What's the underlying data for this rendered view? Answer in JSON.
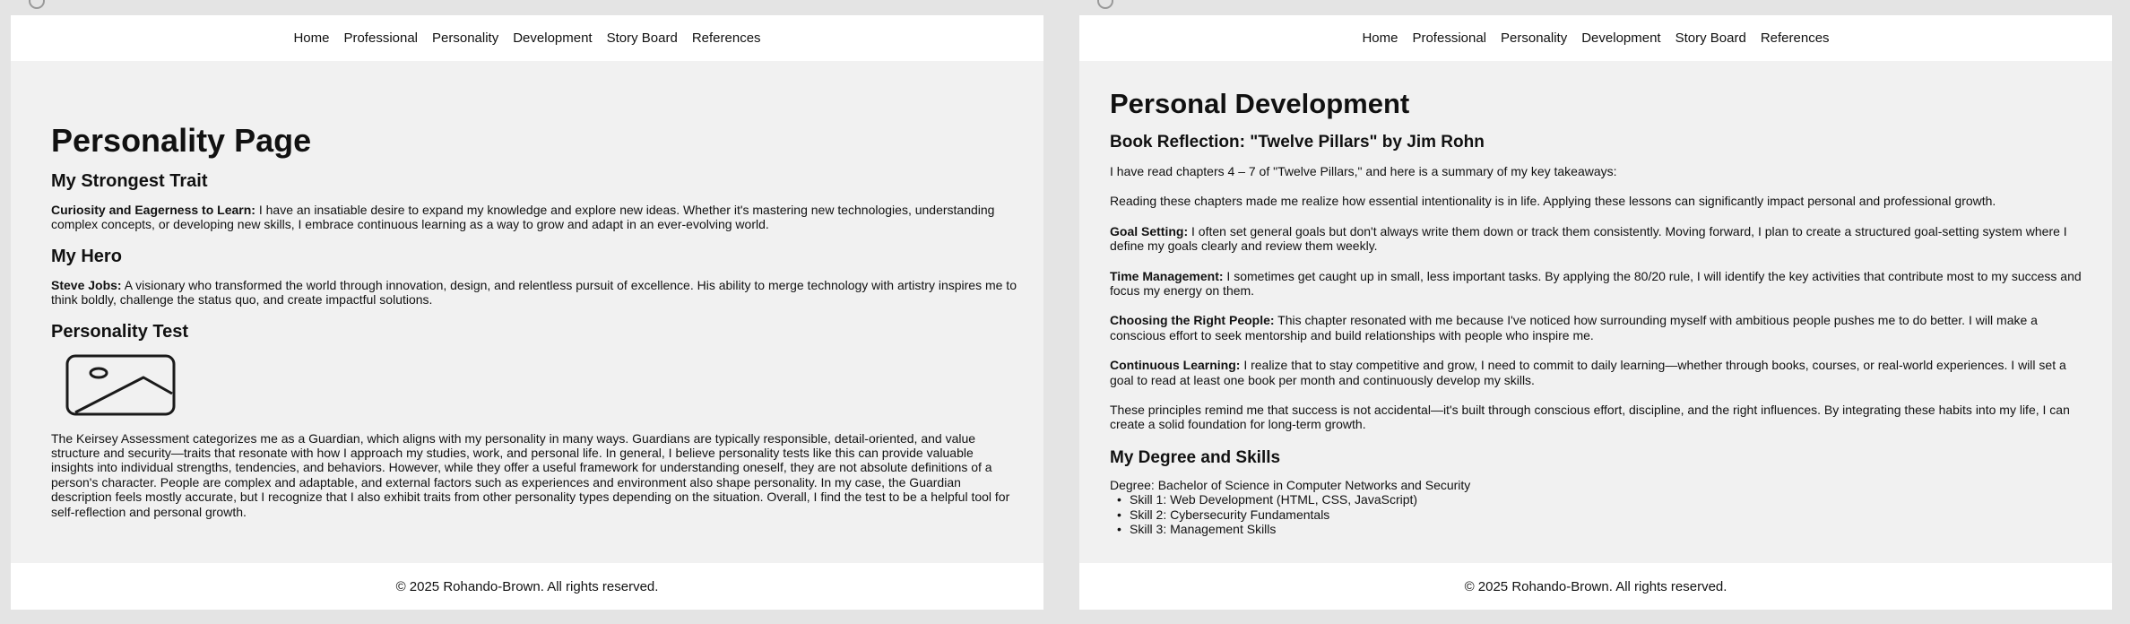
{
  "left_page": {
    "nav": [
      "Home",
      "Professional",
      "Personality",
      "Development",
      "Story Board",
      "References"
    ],
    "title": "Personality Page",
    "trait_heading": "My Strongest Trait",
    "trait_label": "Curiosity and Eagerness to Learn:",
    "trait_text": " I have an insatiable desire to expand my knowledge and explore new ideas. Whether it's mastering  new technologies, understanding complex concepts, or developing new  skills, I embrace continuous learning as a way to grow and adapt in an  ever-evolving world.",
    "hero_heading": "My Hero",
    "hero_label": "Steve Jobs:",
    "hero_text": " A visionary who transformed the world through  innovation, design, and relentless pursuit of excellence. His ability to merge technology with artistry inspires me to think boldly, challenge  the status quo, and create impactful solutions.",
    "test_heading": "Personality Test",
    "test_image_icon": "image-placeholder-icon",
    "test_text": "The Keirsey Assessment categorizes me as a Guardian, which  aligns with my personality in many ways. Guardians are typically  responsible, detail-oriented, and value structure and security—traits  that resonate with how I approach my studies, work, and personal life.  In general, I believe personality tests like this can provide valuable insights into individual strengths, tendencies, and behaviors. However,  while they offer a useful framework for understanding oneself, they are  not absolute definitions of a person's character. People are complex and adaptable, and external factors such as experiences and environment  also shape personality. In my case, the Guardian description feels  mostly accurate, but I recognize that I also exhibit traits from other  personality types depending on the situation. Overall, I find the test  to be a helpful tool for self-reflection and personal growth.",
    "footer": "© 2025 Rohando-Brown. All rights reserved."
  },
  "right_page": {
    "nav": [
      "Home",
      "Professional",
      "Personality",
      "Development",
      "Story Board",
      "References"
    ],
    "title": "Personal Development",
    "book_heading": "Book Reflection: \"Twelve Pillars\" by Jim Rohn",
    "intro": "I have read chapters 4 – 7 of \"Twelve Pillars,\" and here is a summary of my key takeaways:",
    "reflection": "Reading these chapters made me realize how essential  intentionality is in life. Applying these lessons can significantly  impact personal and professional growth.",
    "goal_label": "Goal Setting:",
    "goal_text": " I often set general goals but don't always  write them down or track them consistently. Moving forward, I plan to  create a structured goal-setting system where I define my goals clearly  and review them weekly.",
    "time_label": "Time Management:",
    "time_text": " I sometimes get caught up in small, less  important tasks. By applying the 80/20 rule, I will identify the key  activities that contribute most to my success and focus my energy on  them.",
    "people_label": "Choosing the Right People:",
    "people_text": " This chapter resonated with me  because I've noticed how surrounding myself with ambitious people pushes me to do better. I will make a conscious effort to seek mentorship and  build relationships with people who inspire me.",
    "learning_label": "Continuous Learning:",
    "learning_text": " I realize that to stay competitive and  grow, I need to commit to daily learning—whether through books, courses, or real-world experiences. I will set a goal to read at least one book  per month and continuously develop my skills.",
    "closing": "These principles remind me that success is not  accidental—it's built through conscious effort, discipline, and the  right influences. By integrating these habits into my life, I can create a solid foundation for long-term growth.",
    "degree_heading": "My Degree and Skills",
    "degree": "Degree: Bachelor of Science in Computer Networks and Security",
    "skills": [
      "Skill 1: Web Development (HTML, CSS, JavaScript)",
      "Skill 2: Cybersecurity Fundamentals",
      "Skill 3: Management Skills"
    ],
    "footer": "© 2025 Rohando-Brown. All rights reserved."
  }
}
